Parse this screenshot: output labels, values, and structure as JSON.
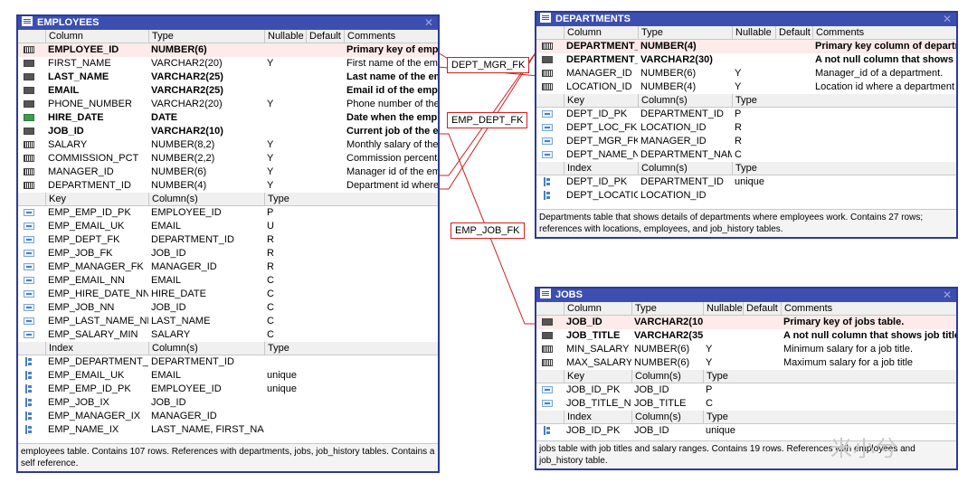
{
  "tables": {
    "employees": {
      "title": "EMPLOYEES",
      "column_headers": [
        "Column",
        "Type",
        "Nullable",
        "Default",
        "Comments"
      ],
      "columns": [
        {
          "name": "EMPLOYEE_ID",
          "type": "NUMBER(6)",
          "nullable": "",
          "default": "",
          "comment": "Primary key of employees table.",
          "icon": "num",
          "pk": true,
          "bold": true
        },
        {
          "name": "FIRST_NAME",
          "type": "VARCHAR2(20)",
          "nullable": "Y",
          "default": "",
          "comment": "First name of the employee.",
          "icon": "txt"
        },
        {
          "name": "LAST_NAME",
          "type": "VARCHAR2(25)",
          "nullable": "",
          "default": "",
          "comment": "Last name of the employee.",
          "icon": "txt",
          "bold": true
        },
        {
          "name": "EMAIL",
          "type": "VARCHAR2(25)",
          "nullable": "",
          "default": "",
          "comment": "Email id of the employee.",
          "icon": "txt",
          "bold": true
        },
        {
          "name": "PHONE_NUMBER",
          "type": "VARCHAR2(20)",
          "nullable": "Y",
          "default": "",
          "comment": "Phone number of the employee.",
          "icon": "txt"
        },
        {
          "name": "HIRE_DATE",
          "type": "DATE",
          "nullable": "",
          "default": "",
          "comment": "Date when the employee started.",
          "icon": "dat",
          "bold": true
        },
        {
          "name": "JOB_ID",
          "type": "VARCHAR2(10)",
          "nullable": "",
          "default": "",
          "comment": "Current job of the employee.",
          "icon": "txt",
          "bold": true
        },
        {
          "name": "SALARY",
          "type": "NUMBER(8,2)",
          "nullable": "Y",
          "default": "",
          "comment": "Monthly salary of the employee.",
          "icon": "num"
        },
        {
          "name": "COMMISSION_PCT",
          "type": "NUMBER(2,2)",
          "nullable": "Y",
          "default": "",
          "comment": "Commission percentage of the employee.",
          "icon": "num"
        },
        {
          "name": "MANAGER_ID",
          "type": "NUMBER(6)",
          "nullable": "Y",
          "default": "",
          "comment": "Manager id of the employee.",
          "icon": "num"
        },
        {
          "name": "DEPARTMENT_ID",
          "type": "NUMBER(4)",
          "nullable": "Y",
          "default": "",
          "comment": "Department id where employee works.",
          "icon": "num"
        }
      ],
      "key_headers": [
        "Key",
        "Column(s)",
        "Type"
      ],
      "keys": [
        {
          "name": "EMP_EMP_ID_PK",
          "cols": "EMPLOYEE_ID",
          "type": "P"
        },
        {
          "name": "EMP_EMAIL_UK",
          "cols": "EMAIL",
          "type": "U"
        },
        {
          "name": "EMP_DEPT_FK",
          "cols": "DEPARTMENT_ID",
          "type": "R"
        },
        {
          "name": "EMP_JOB_FK",
          "cols": "JOB_ID",
          "type": "R"
        },
        {
          "name": "EMP_MANAGER_FK",
          "cols": "MANAGER_ID",
          "type": "R"
        },
        {
          "name": "EMP_EMAIL_NN",
          "cols": "EMAIL",
          "type": "C"
        },
        {
          "name": "EMP_HIRE_DATE_NN",
          "cols": "HIRE_DATE",
          "type": "C"
        },
        {
          "name": "EMP_JOB_NN",
          "cols": "JOB_ID",
          "type": "C"
        },
        {
          "name": "EMP_LAST_NAME_NN",
          "cols": "LAST_NAME",
          "type": "C"
        },
        {
          "name": "EMP_SALARY_MIN",
          "cols": "SALARY",
          "type": "C"
        }
      ],
      "index_headers": [
        "Index",
        "Column(s)",
        "Type"
      ],
      "indexes": [
        {
          "name": "EMP_DEPARTMENT_IX",
          "cols": "DEPARTMENT_ID",
          "type": ""
        },
        {
          "name": "EMP_EMAIL_UK",
          "cols": "EMAIL",
          "type": "unique"
        },
        {
          "name": "EMP_EMP_ID_PK",
          "cols": "EMPLOYEE_ID",
          "type": "unique"
        },
        {
          "name": "EMP_JOB_IX",
          "cols": "JOB_ID",
          "type": ""
        },
        {
          "name": "EMP_MANAGER_IX",
          "cols": "MANAGER_ID",
          "type": ""
        },
        {
          "name": "EMP_NAME_IX",
          "cols": "LAST_NAME, FIRST_NAME",
          "type": ""
        }
      ],
      "footer": "employees table. Contains 107 rows. References with departments, jobs, job_history tables. Contains a self reference."
    },
    "departments": {
      "title": "DEPARTMENTS",
      "column_headers": [
        "Column",
        "Type",
        "Nullable",
        "Default",
        "Comments"
      ],
      "columns": [
        {
          "name": "DEPARTMENT_ID",
          "type": "NUMBER(4)",
          "nullable": "",
          "default": "",
          "comment": "Primary key column of departments table.",
          "icon": "num",
          "pk": true,
          "bold": true
        },
        {
          "name": "DEPARTMENT_NAME",
          "type": "VARCHAR2(30)",
          "nullable": "",
          "default": "",
          "comment": "A not null column that shows name of a department.",
          "icon": "txt",
          "bold": true
        },
        {
          "name": "MANAGER_ID",
          "type": "NUMBER(6)",
          "nullable": "Y",
          "default": "",
          "comment": "Manager_id of a department.",
          "icon": "num"
        },
        {
          "name": "LOCATION_ID",
          "type": "NUMBER(4)",
          "nullable": "Y",
          "default": "",
          "comment": "Location id where a department is located.",
          "icon": "num"
        }
      ],
      "key_headers": [
        "Key",
        "Column(s)",
        "Type"
      ],
      "keys": [
        {
          "name": "DEPT_ID_PK",
          "cols": "DEPARTMENT_ID",
          "type": "P"
        },
        {
          "name": "DEPT_LOC_FK",
          "cols": "LOCATION_ID",
          "type": "R"
        },
        {
          "name": "DEPT_MGR_FK",
          "cols": "MANAGER_ID",
          "type": "R"
        },
        {
          "name": "DEPT_NAME_NN",
          "cols": "DEPARTMENT_NAME",
          "type": "C"
        }
      ],
      "index_headers": [
        "Index",
        "Column(s)",
        "Type"
      ],
      "indexes": [
        {
          "name": "DEPT_ID_PK",
          "cols": "DEPARTMENT_ID",
          "type": "unique"
        },
        {
          "name": "DEPT_LOCATION_IX",
          "cols": "LOCATION_ID",
          "type": ""
        }
      ],
      "footer": "Departments table that shows details of departments where employees work. Contains 27 rows; references with locations, employees, and job_history tables."
    },
    "jobs": {
      "title": "JOBS",
      "column_headers": [
        "Column",
        "Type",
        "Nullable",
        "Default",
        "Comments"
      ],
      "columns": [
        {
          "name": "JOB_ID",
          "type": "VARCHAR2(10)",
          "nullable": "",
          "default": "",
          "comment": "Primary key of jobs table.",
          "icon": "txt",
          "pk": true,
          "bold": true
        },
        {
          "name": "JOB_TITLE",
          "type": "VARCHAR2(35)",
          "nullable": "",
          "default": "",
          "comment": "A not null column that shows job title, e.g. AD_VP, FI_ACCOUNTANT",
          "icon": "txt",
          "bold": true
        },
        {
          "name": "MIN_SALARY",
          "type": "NUMBER(6)",
          "nullable": "Y",
          "default": "",
          "comment": "Minimum salary for a job title.",
          "icon": "num"
        },
        {
          "name": "MAX_SALARY",
          "type": "NUMBER(6)",
          "nullable": "Y",
          "default": "",
          "comment": "Maximum salary for a job title",
          "icon": "num"
        }
      ],
      "key_headers": [
        "Key",
        "Column(s)",
        "Type"
      ],
      "keys": [
        {
          "name": "JOB_ID_PK",
          "cols": "JOB_ID",
          "type": "P"
        },
        {
          "name": "JOB_TITLE_NN",
          "cols": "JOB_TITLE",
          "type": "C"
        }
      ],
      "index_headers": [
        "Index",
        "Column(s)",
        "Type"
      ],
      "indexes": [
        {
          "name": "JOB_ID_PK",
          "cols": "JOB_ID",
          "type": "unique"
        }
      ],
      "footer": "jobs table with job titles and salary ranges. Contains 19 rows. References with employees and job_history table."
    }
  },
  "relations": [
    {
      "label": "DEPT_MGR_FK"
    },
    {
      "label": "EMP_DEPT_FK"
    },
    {
      "label": "EMP_JOB_FK"
    }
  ],
  "watermark": "米小兮",
  "colors": {
    "title_bar": "#3c4fb0",
    "border": "#2b3a9a",
    "relation": "#d02020",
    "pk_row": "#fdeaea"
  }
}
